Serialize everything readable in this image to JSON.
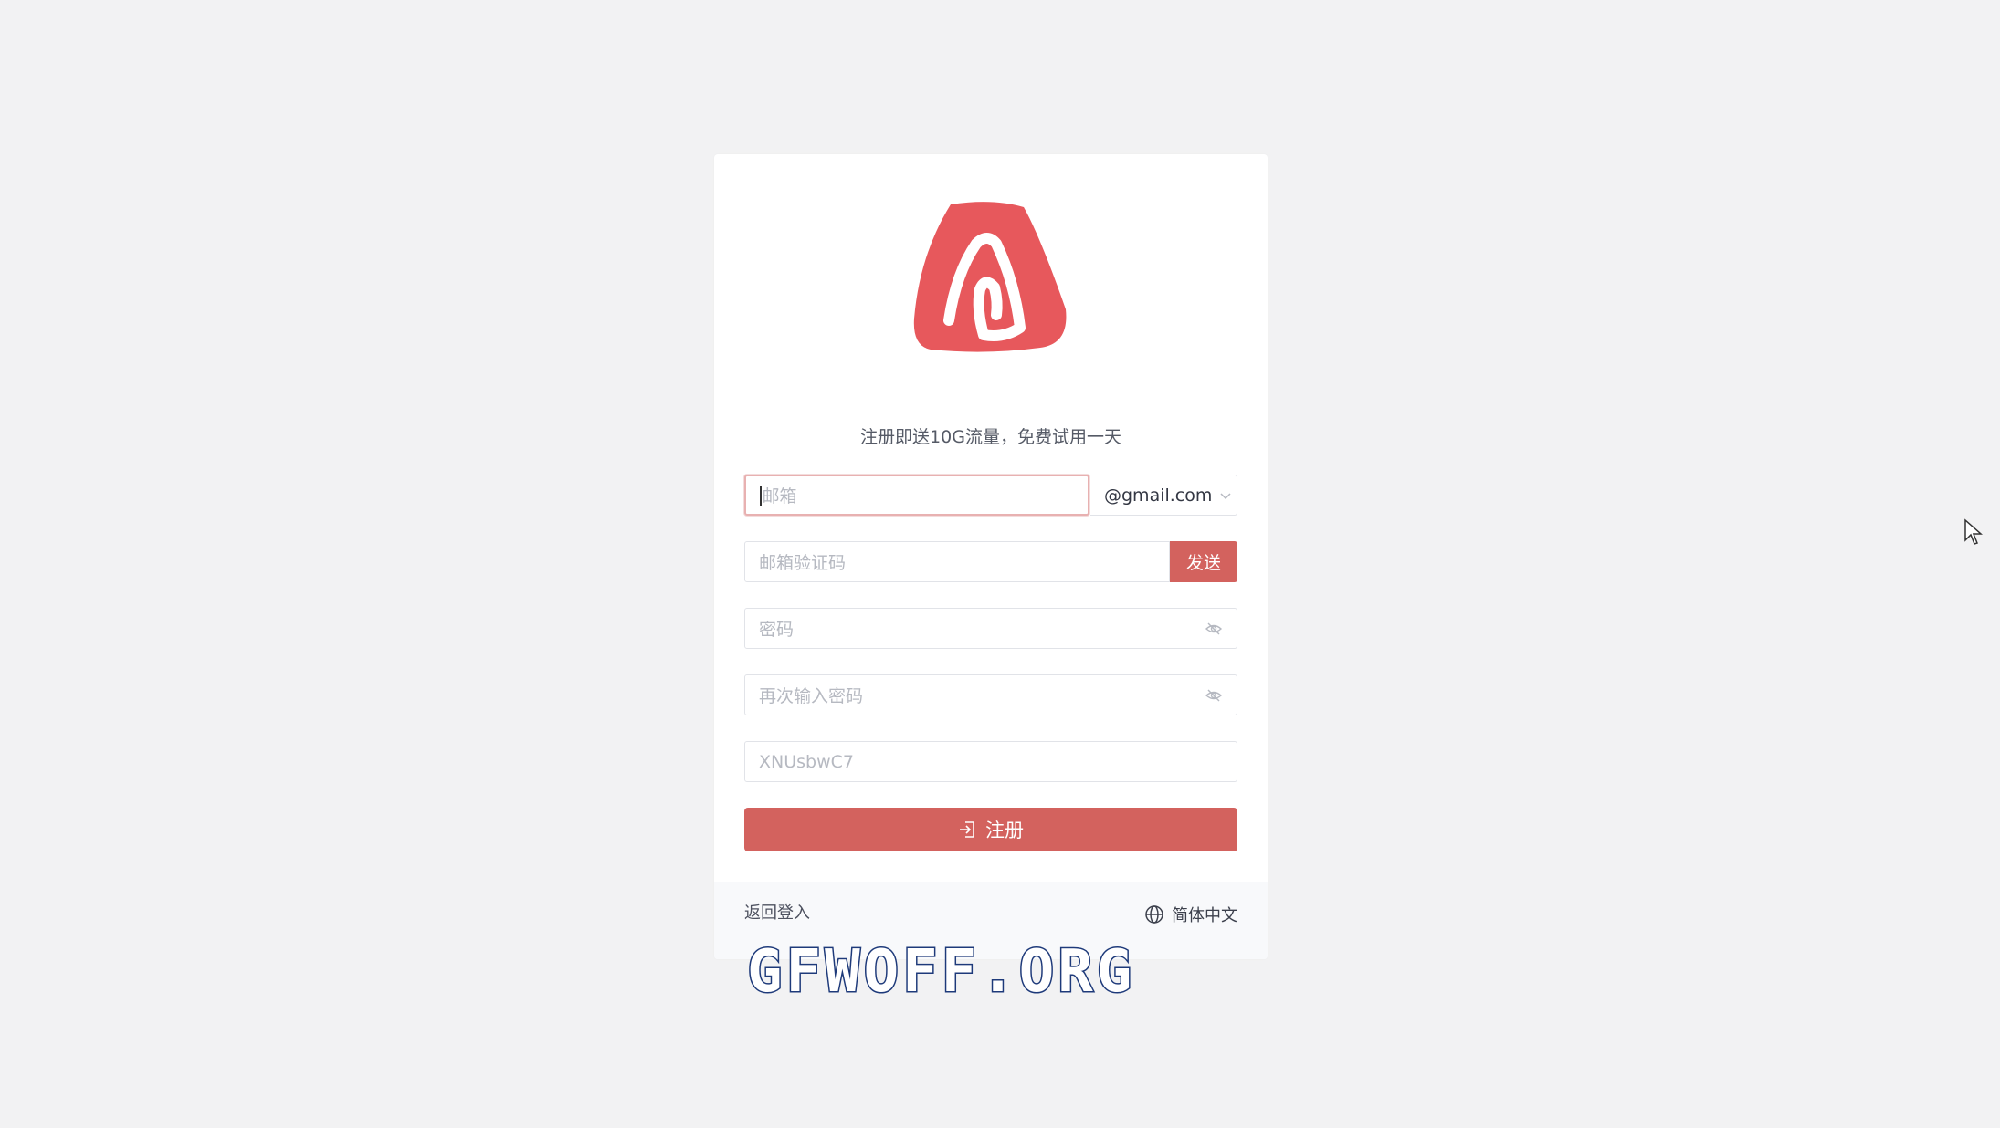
{
  "card": {
    "tagline": "注册即送10G流量，免费试用一天",
    "email_placeholder": "邮箱",
    "email_domain": "@gmail.com",
    "code_placeholder": "邮箱验证码",
    "send_label": "发送",
    "password_placeholder": "密码",
    "password_confirm_placeholder": "再次输入密码",
    "invite_code": "XNUsbwC7",
    "register_label": "注册",
    "back_login": "返回登入",
    "language": "简体中文"
  },
  "watermark": "GFWOFF.ORG",
  "colors": {
    "accent": "#d3625e",
    "logo": "#e7585c",
    "background": "#f2f2f3"
  },
  "icons": [
    "logo-icon",
    "chevron-down-icon",
    "eye-off-icon",
    "login-icon",
    "globe-icon",
    "cursor-icon"
  ]
}
